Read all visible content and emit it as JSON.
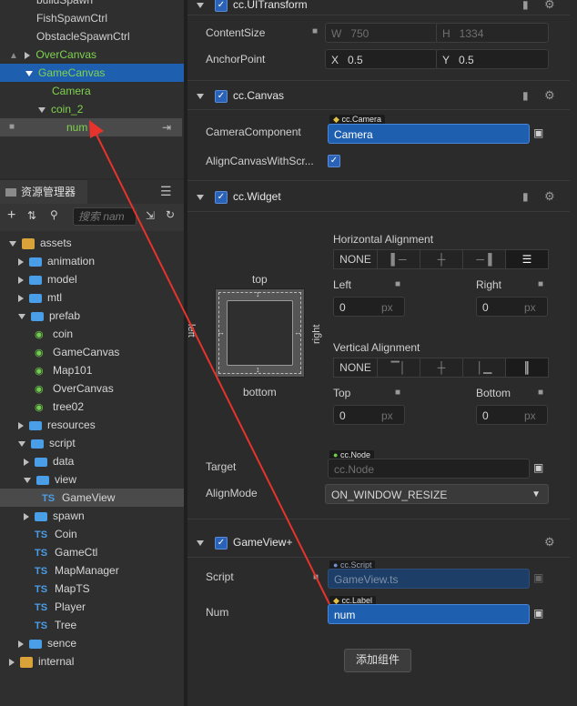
{
  "hierarchy": {
    "items": [
      {
        "label": "buildSpawn"
      },
      {
        "label": "FishSpawnCtrl"
      },
      {
        "label": "ObstacleSpawnCtrl"
      },
      {
        "label": "OverCanvas"
      },
      {
        "label": "GameCanvas"
      },
      {
        "label": "Camera"
      },
      {
        "label": "coin_2"
      },
      {
        "label": "num"
      }
    ]
  },
  "assets": {
    "tab_label": "资源管理器",
    "search_placeholder": "搜索 nam",
    "tree": [
      {
        "label": "assets"
      },
      {
        "label": "animation"
      },
      {
        "label": "model"
      },
      {
        "label": "mtl"
      },
      {
        "label": "prefab"
      },
      {
        "label": "coin"
      },
      {
        "label": "GameCanvas"
      },
      {
        "label": "Map101"
      },
      {
        "label": "OverCanvas"
      },
      {
        "label": "tree02"
      },
      {
        "label": "resources"
      },
      {
        "label": "script"
      },
      {
        "label": "data"
      },
      {
        "label": "view"
      },
      {
        "label": "GameView"
      },
      {
        "label": "spawn"
      },
      {
        "label": "Coin"
      },
      {
        "label": "GameCtl"
      },
      {
        "label": "MapManager"
      },
      {
        "label": "MapTS"
      },
      {
        "label": "Player"
      },
      {
        "label": "Tree"
      },
      {
        "label": "sence"
      },
      {
        "label": "internal"
      }
    ],
    "ts_badge": "TS"
  },
  "inspector": {
    "ui_transform": {
      "title": "cc.UITransform",
      "content_size_label": "ContentSize",
      "w_label": "W",
      "w_value": "750",
      "h_label": "H",
      "h_value": "1334",
      "anchor_label": "AnchorPoint",
      "x_label": "X",
      "x_value": "0.5",
      "y_label": "Y",
      "y_value": "0.5"
    },
    "canvas": {
      "title": "cc.Canvas",
      "camera_label": "CameraComponent",
      "camera_tag": "cc.Camera",
      "camera_value": "Camera",
      "align_label": "AlignCanvasWithScr..."
    },
    "widget": {
      "title": "cc.Widget",
      "horizontal_label": "Horizontal Alignment",
      "none_label": "NONE",
      "top_label": "top",
      "bottom_label": "bottom",
      "left_side_label": "left",
      "right_side_label": "right",
      "left_label": "Left",
      "left_value": "0",
      "left_unit": "px",
      "right_label": "Right",
      "right_value": "0",
      "right_unit": "px",
      "vertical_label": "Vertical Alignment",
      "top_field_label": "Top",
      "top_value": "0",
      "top_unit": "px",
      "bottom_field_label": "Bottom",
      "bottom_value": "0",
      "bottom_unit": "px",
      "target_label": "Target",
      "target_tag": "cc.Node",
      "target_value": "cc.Node",
      "align_mode_label": "AlignMode",
      "align_mode_value": "ON_WINDOW_RESIZE"
    },
    "game_view": {
      "title": "GameView+",
      "script_label": "Script",
      "script_tag": "cc.Script",
      "script_value": "GameView.ts",
      "num_label": "Num",
      "num_tag": "cc.Label",
      "num_value": "num"
    },
    "add_component_label": "添加组件"
  },
  "colors": {
    "accent": "#1f5fb0",
    "node_green": "#7fd34e",
    "annotation_arrow": "#e8332c"
  }
}
